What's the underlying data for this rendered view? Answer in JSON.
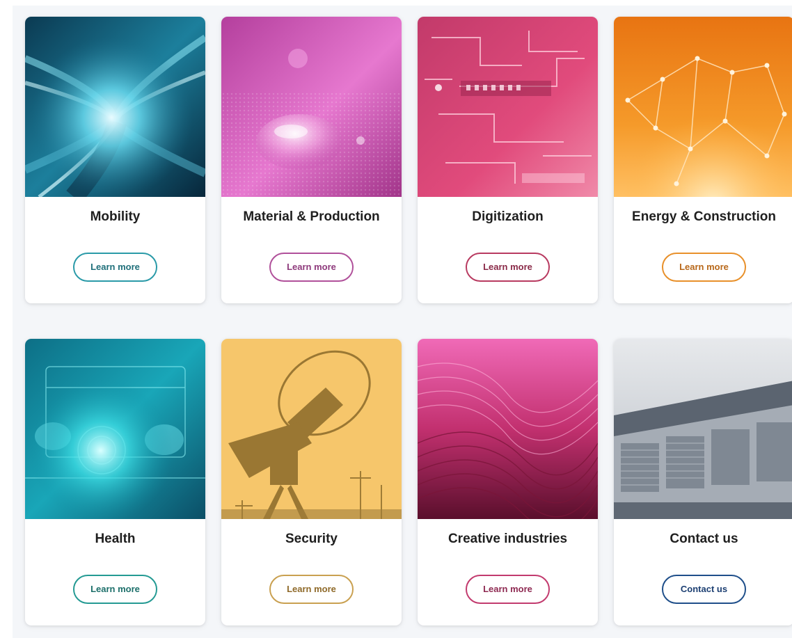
{
  "cards": [
    {
      "title": "Mobility",
      "button_label": "Learn more",
      "image": "tunnel-photo",
      "accent_color": "#2a9aa8"
    },
    {
      "title": "Material & Production",
      "button_label": "Learn more",
      "image": "water-droplet-on-fabric-photo",
      "accent_color": "#b0509a"
    },
    {
      "title": "Digitization",
      "button_label": "Learn more",
      "image": "circuit-board-photo",
      "accent_color": "#b83a60"
    },
    {
      "title": "Energy & Construction",
      "button_label": "Learn more",
      "image": "network-nodes-photo",
      "accent_color": "#e8902a"
    },
    {
      "title": "Health",
      "button_label": "Learn more",
      "image": "medical-interface-photo",
      "accent_color": "#249a93"
    },
    {
      "title": "Security",
      "button_label": "Learn more",
      "image": "satellite-dish-photo",
      "accent_color": "#c9a050"
    },
    {
      "title": "Creative industries",
      "button_label": "Learn more",
      "image": "abstract-waves-photo",
      "accent_color": "#c23a6e"
    },
    {
      "title": "Contact us",
      "button_label": "Contact us",
      "image": "office-building-photo",
      "accent_color": "#1f4f8a"
    }
  ]
}
